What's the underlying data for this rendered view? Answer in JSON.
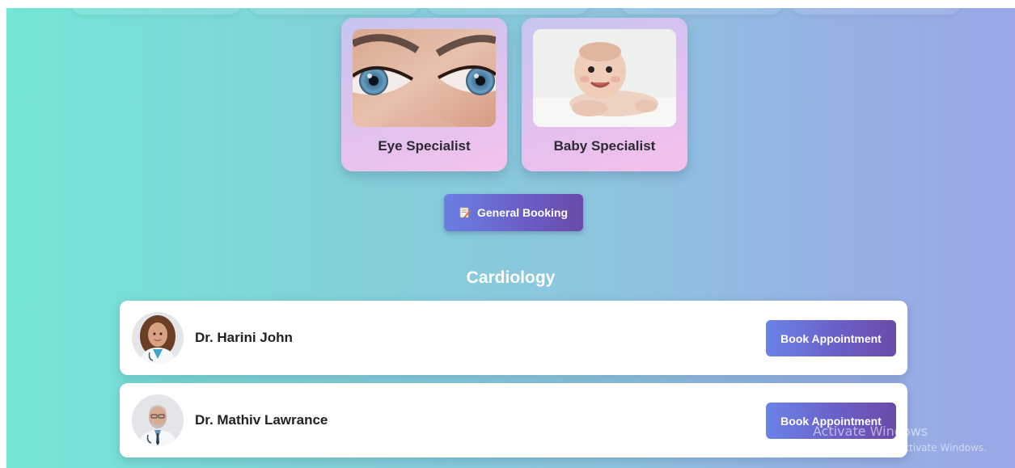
{
  "specialists": [
    {
      "label": "Eye Specialist",
      "image": "eyes-photo"
    },
    {
      "label": "Baby Specialist",
      "image": "baby-photo"
    }
  ],
  "general_booking": {
    "label": "General Booking",
    "icon": "memo-icon"
  },
  "section": {
    "title": "Cardiology"
  },
  "doctors": [
    {
      "name": "Dr. Harini John",
      "button": "Book Appointment",
      "avatar": "female-doctor-photo"
    },
    {
      "name": "Dr. Mathiv Lawrance",
      "button": "Book Appointment",
      "avatar": "male-doctor-photo"
    }
  ],
  "watermark": {
    "title": "Activate Windows",
    "subtitle": "Go to Settings to activate Windows."
  },
  "colors": {
    "bg_start": "#74e6d4",
    "bg_end": "#9ba7e6",
    "button_start": "#6b82e6",
    "button_end": "#6c4aa6"
  }
}
